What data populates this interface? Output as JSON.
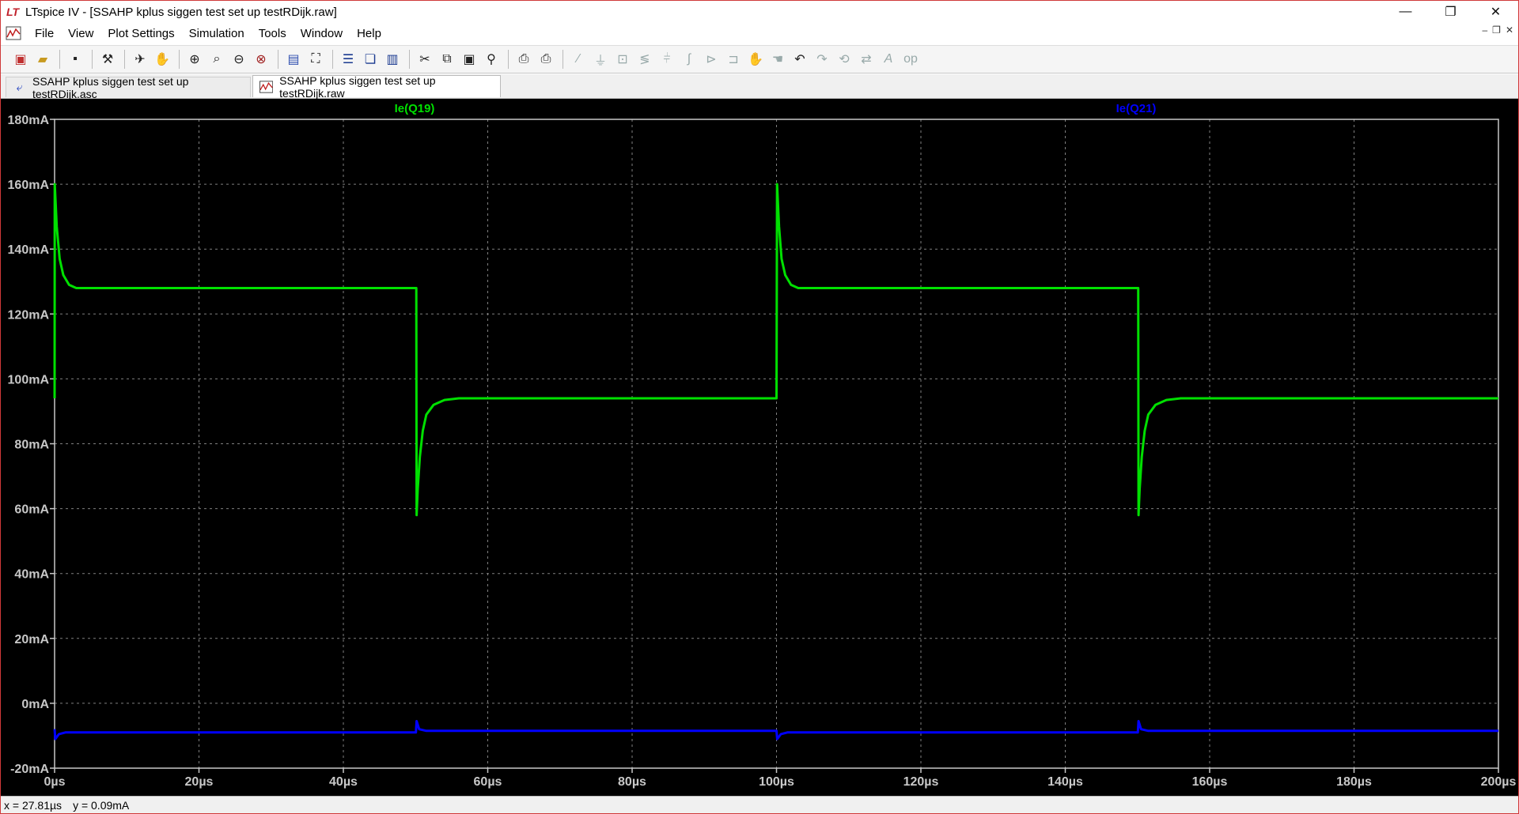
{
  "window": {
    "title": "LTspice IV - [SSAHP kplus siggen test set up testRDijk.raw]",
    "controls": {
      "minimize": "—",
      "restore": "❐",
      "close": "✕"
    }
  },
  "menu": [
    "File",
    "View",
    "Plot Settings",
    "Simulation",
    "Tools",
    "Window",
    "Help"
  ],
  "toolbar_icons": [
    "new-schematic-icon",
    "open-icon",
    "save-icon",
    "control-panel-icon",
    "run-icon",
    "halt-icon",
    "zoom-in-icon",
    "zoom-area-icon",
    "zoom-out-icon",
    "zoom-cancel-icon",
    "autorange-icon",
    "zoom-extents-icon",
    "tile-horizontal-icon",
    "cascade-icon",
    "tile-vertical-icon",
    "cut-icon",
    "copy-icon",
    "paste-icon",
    "find-icon",
    "print-setup-icon",
    "print-icon",
    "wire-icon",
    "ground-icon",
    "label-icon",
    "resistor-icon",
    "capacitor-icon",
    "inductor-icon",
    "diode-icon",
    "component-icon",
    "move-icon",
    "drag-icon",
    "undo-icon",
    "redo-icon",
    "rotate-icon",
    "mirror-icon",
    "text-icon",
    "spice-directive-icon"
  ],
  "tabs": [
    {
      "label": "SSAHP kplus siggen test set up testRDijk.asc",
      "icon": "schematic-icon"
    },
    {
      "label": "SSAHP kplus siggen test set up testRDijk.raw",
      "icon": "waveform-icon"
    }
  ],
  "status": {
    "x": "x = 27.81µs",
    "y": "y = 0.09mA"
  },
  "colors": {
    "background": "#000000",
    "grid": "#808080",
    "trace1": "#00e000",
    "trace2": "#0000ff"
  },
  "chart_data": {
    "type": "line",
    "xlim": [
      0,
      200
    ],
    "ylim": [
      -20,
      180
    ],
    "x_unit": "µs",
    "y_unit": "mA",
    "x_ticks": [
      "0µs",
      "20µs",
      "40µs",
      "60µs",
      "80µs",
      "100µs",
      "120µs",
      "140µs",
      "160µs",
      "180µs",
      "200µs"
    ],
    "y_ticks": [
      "180mA",
      "160mA",
      "140mA",
      "120mA",
      "100mA",
      "80mA",
      "60mA",
      "40mA",
      "20mA",
      "0mA",
      "-20mA"
    ],
    "grid": true,
    "series": [
      {
        "name": "Ie(Q19)",
        "color": "#00e000",
        "x": [
          0,
          0.02,
          0.3,
          0.7,
          1.2,
          2,
          3,
          5,
          50.1,
          50.15,
          50.3,
          50.6,
          51,
          51.5,
          52.5,
          54,
          56,
          100,
          100.08,
          100.35,
          100.7,
          101.2,
          102,
          103,
          105,
          150.1,
          150.15,
          150.3,
          150.6,
          151,
          151.5,
          152.5,
          154,
          156,
          200
        ],
        "y": [
          94,
          160,
          147,
          137,
          132,
          129,
          128,
          128,
          128,
          58,
          66,
          76,
          84,
          89,
          92,
          93.5,
          94,
          94,
          160,
          147,
          137,
          132,
          129,
          128,
          128,
          128,
          58,
          66,
          76,
          84,
          89,
          92,
          93.5,
          94,
          94
        ]
      },
      {
        "name": "Ie(Q21)",
        "color": "#0000ff",
        "x": [
          0,
          0.1,
          0.6,
          1.5,
          3,
          50.05,
          50.15,
          50.5,
          51.5,
          53,
          100,
          100.1,
          100.6,
          101.5,
          103,
          150.05,
          150.15,
          150.5,
          151.5,
          153,
          200
        ],
        "y": [
          -8,
          -11,
          -9.5,
          -9,
          -9,
          -9,
          -5.5,
          -8,
          -8.5,
          -8.5,
          -8.5,
          -11,
          -9.5,
          -9,
          -9,
          -9,
          -5.5,
          -8,
          -8.5,
          -8.5,
          -8.5
        ]
      }
    ]
  }
}
